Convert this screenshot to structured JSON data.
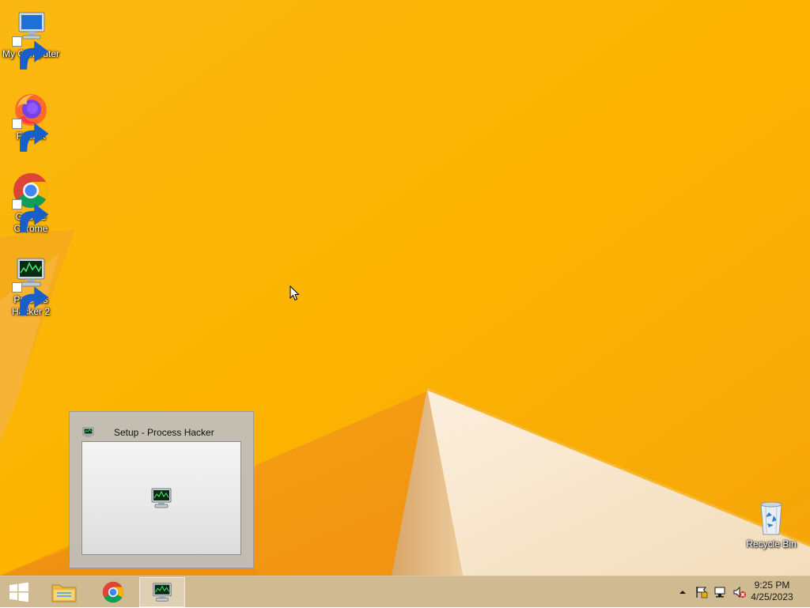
{
  "desktop": {
    "icons": [
      {
        "label": "My Computer",
        "icon": "computer-icon"
      },
      {
        "label": "Firefox",
        "icon": "firefox-icon"
      },
      {
        "label": "Google Chrome",
        "icon": "chrome-icon"
      },
      {
        "label": "Process Hacker 2",
        "icon": "process-hacker-icon"
      },
      {
        "label": "Recycle Bin",
        "icon": "recycle-bin-icon"
      }
    ]
  },
  "thumbnail": {
    "title": "Setup - Process Hacker"
  },
  "taskbar": {
    "start_icon": "windows-logo-icon",
    "pinned": [
      {
        "name": "File Explorer",
        "icon": "folder-icon"
      },
      {
        "name": "Google Chrome",
        "icon": "chrome-icon"
      },
      {
        "name": "Process Hacker Setup",
        "icon": "process-hacker-icon",
        "active": true
      }
    ],
    "tray": {
      "icons": [
        "show-hidden-icons-chevron",
        "action-center-flag-icon",
        "network-icon",
        "volume-muted-icon"
      ],
      "time": "9:25 PM",
      "date": "4/25/2023"
    }
  },
  "colors": {
    "wallpaper_orange": "#fbb500",
    "taskbar": "#ceb78c",
    "accent_white_shape": "#f6e7cf"
  }
}
